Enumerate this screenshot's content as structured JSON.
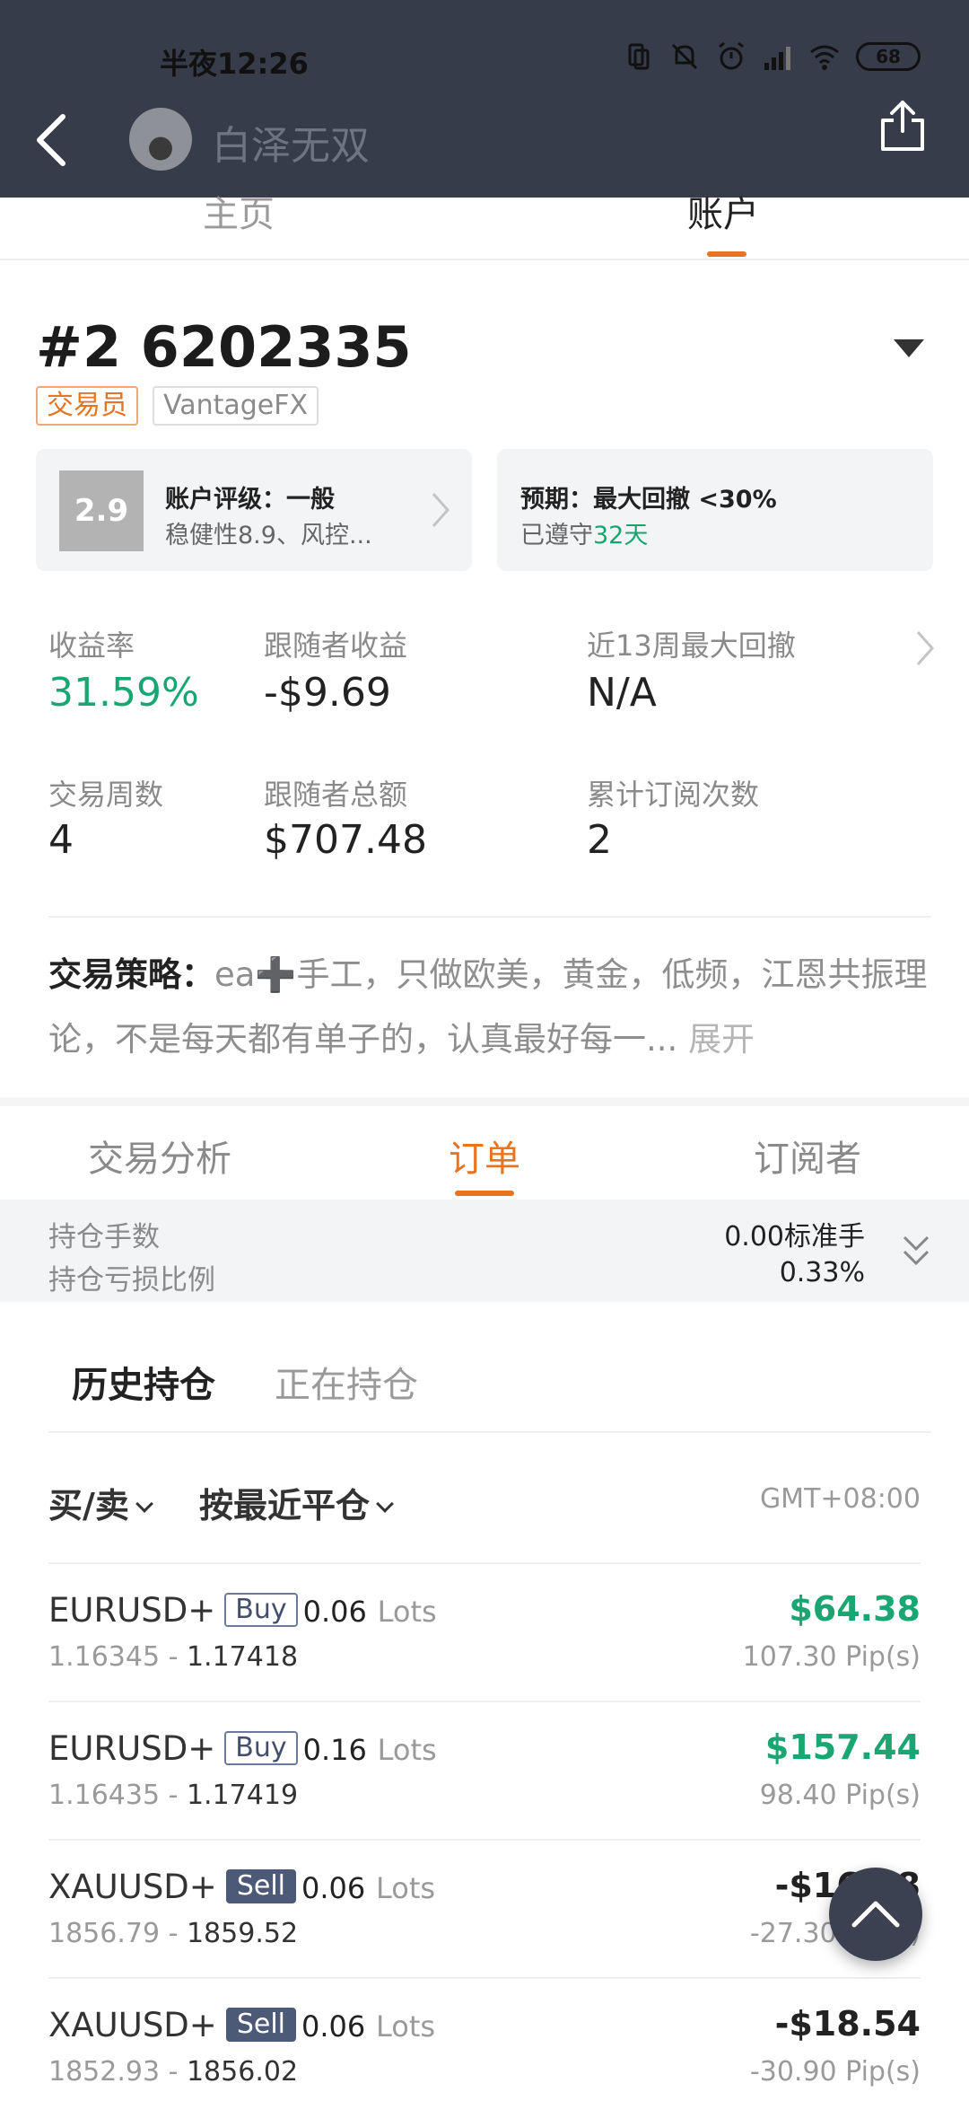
{
  "status_bar": {
    "time": "半夜12:26",
    "battery": "68"
  },
  "header": {
    "username": "白泽无双"
  },
  "top_tabs": {
    "home": "主页",
    "account": "账户"
  },
  "account": {
    "title": "#2 6202335",
    "tag_role": "交易员",
    "tag_broker": "VantageFX",
    "rating": {
      "score": "2.9",
      "line1": "账户评级：一般",
      "line2": "稳健性8.9、风控..."
    },
    "expectation": {
      "line1": "预期：最大回撤 <30%",
      "line2_prefix": "已遵守",
      "line2_days": "32天"
    }
  },
  "stats": {
    "return_label": "收益率",
    "return_value": "31.59%",
    "follower_profit_label": "跟随者收益",
    "follower_profit_value": "-$9.69",
    "max_drawdown_label": "近13周最大回撤",
    "max_drawdown_value": "N/A",
    "weeks_label": "交易周数",
    "weeks_value": "4",
    "follower_total_label": "跟随者总额",
    "follower_total_value": "$707.48",
    "subs_label": "累计订阅次数",
    "subs_value": "2"
  },
  "strategy": {
    "label": "交易策略：",
    "text": "ea➕手工，只做欧美，黄金，低频，江恩共振理论，不是每天都有单子的，认真最好每一...",
    "expand": "展开"
  },
  "section_tabs": {
    "analysis": "交易分析",
    "orders": "订单",
    "subscribers": "订阅者"
  },
  "position_summary": {
    "lots_label": "持仓手数",
    "lots_value": "0.00标准手",
    "pl_ratio_label": "持仓亏损比例",
    "pl_ratio_value": "0.33%"
  },
  "history_tabs": {
    "history": "历史持仓",
    "open": "正在持仓"
  },
  "filters": {
    "side": "买/卖",
    "sort": "按最近平仓",
    "timezone": "GMT+08:00"
  },
  "lots_unit": "Lots",
  "orders": [
    {
      "symbol": "EURUSD+",
      "side": "Buy",
      "lots": "0.06",
      "open": "1.16345",
      "sep": " - ",
      "close": "1.17418",
      "pnl": "$64.38",
      "pips": "107.30 Pip(s)",
      "positive": true
    },
    {
      "symbol": "EURUSD+",
      "side": "Buy",
      "lots": "0.16",
      "open": "1.16435",
      "sep": " - ",
      "close": "1.17419",
      "pnl": "$157.44",
      "pips": "98.40 Pip(s)",
      "positive": true
    },
    {
      "symbol": "XAUUSD+",
      "side": "Sell",
      "lots": "0.06",
      "open": "1856.79",
      "sep": " - ",
      "close": "1859.52",
      "pnl": "-$16.38",
      "pips": "-27.30 Pip(s)",
      "positive": false
    },
    {
      "symbol": "XAUUSD+",
      "side": "Sell",
      "lots": "0.06",
      "open": "1852.93",
      "sep": " - ",
      "close": "1856.02",
      "pnl": "-$18.54",
      "pips": "-30.90 Pip(s)",
      "positive": false
    }
  ]
}
